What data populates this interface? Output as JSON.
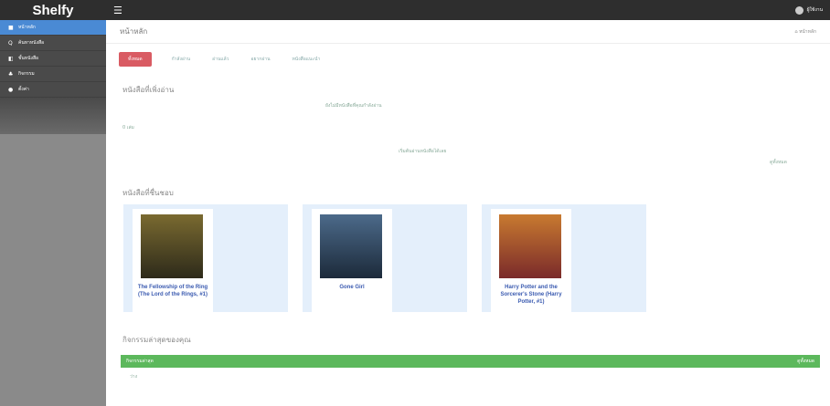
{
  "app": {
    "brand": "Shelfy"
  },
  "sidebar": {
    "items": [
      {
        "label": "หน้าหลัก",
        "icon": "home-icon",
        "glyph": "■",
        "active": true
      },
      {
        "label": "ค้นหาหนังสือ",
        "icon": "search-icon",
        "glyph": "Q",
        "active": false
      },
      {
        "label": "ชั้นหนังสือ",
        "icon": "book-icon",
        "glyph": "◧",
        "active": false
      },
      {
        "label": "กิจกรรม",
        "icon": "activity-icon",
        "glyph": "♣",
        "active": false
      },
      {
        "label": "ตั้งค่า",
        "icon": "settings-icon",
        "glyph": "●",
        "active": false
      }
    ]
  },
  "topbar": {
    "user_name": "ผู้ใช้งาน"
  },
  "main": {
    "page_title": "หน้าหลัก",
    "crumb": "หน้าหลัก",
    "tabs": [
      {
        "label": "ทั้งหมด",
        "active": true
      },
      {
        "label": "กำลังอ่าน",
        "active": false
      },
      {
        "label": "อ่านแล้ว",
        "active": false
      },
      {
        "label": "อยากอ่าน",
        "active": false
      },
      {
        "label": "หนังสือแนะนำ",
        "active": false
      }
    ],
    "recent_section": {
      "title": "หนังสือที่เพิ่งอ่าน",
      "empty_msg": "ยังไม่มีหนังสือที่คุณกำลังอ่าน",
      "count_text": "0 เล่ม",
      "hint": "เริ่มต้นอ่านหนังสือได้เลย",
      "more": "ดูทั้งหมด"
    },
    "favorites_title": "หนังสือที่ชื่นชอบ",
    "books": [
      {
        "title": "The Fellowship of the Ring (The Lord of the Rings, #1)",
        "cover_top": "#7a6a30",
        "cover_bottom": "#2d2a1a"
      },
      {
        "title": "Gone Girl",
        "cover_top": "#4c6a8a",
        "cover_bottom": "#1c2a3a"
      },
      {
        "title": "Harry Potter and the Sorcerer's Stone (Harry Potter, #1)",
        "cover_top": "#c87a30",
        "cover_bottom": "#7a2a2a"
      }
    ],
    "activity_section": {
      "title": "กิจกรรมล่าสุดของคุณ",
      "bar_left": "กิจกรรมล่าสุด",
      "bar_right": "ดูทั้งหมด",
      "row_text": "ว่าง"
    }
  }
}
